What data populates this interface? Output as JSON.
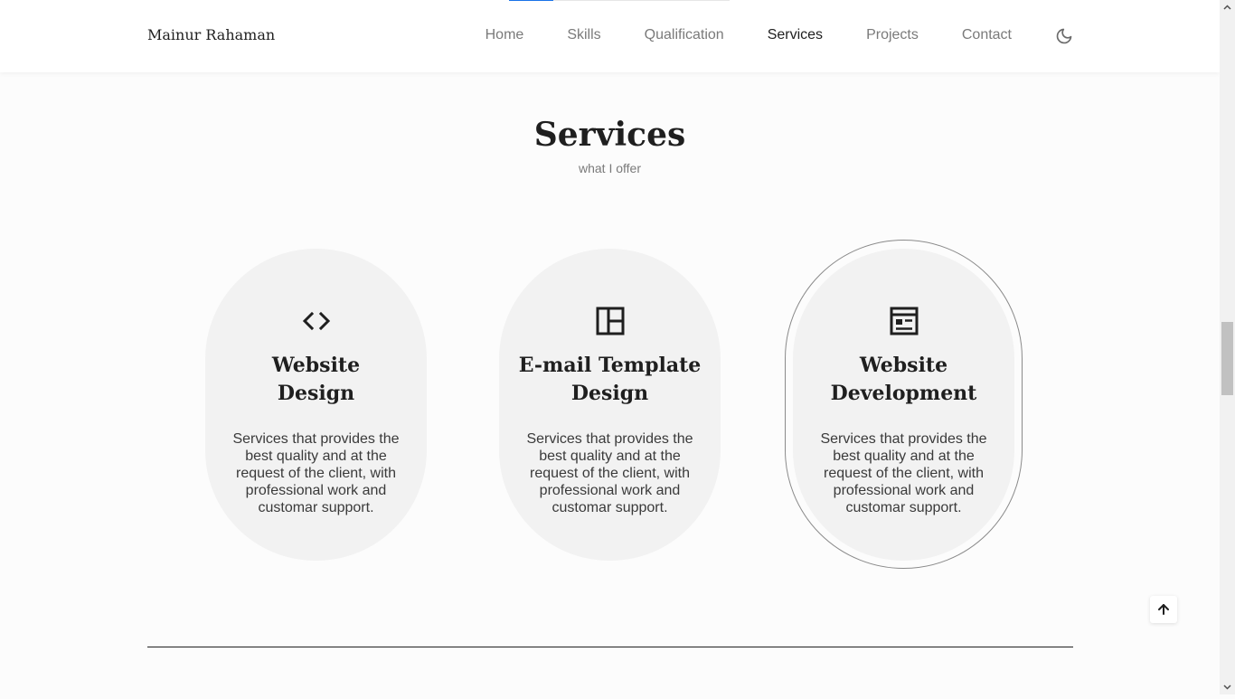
{
  "header": {
    "brand": "Mainur Rahaman",
    "nav": [
      {
        "label": "Home",
        "active": false
      },
      {
        "label": "Skills",
        "active": false
      },
      {
        "label": "Qualification",
        "active": false
      },
      {
        "label": "Services",
        "active": true
      },
      {
        "label": "Projects",
        "active": false
      },
      {
        "label": "Contact",
        "active": false
      }
    ],
    "theme_icon": "moon-icon"
  },
  "scroll_progress": 0.2,
  "section": {
    "title": "Services",
    "subtitle": "what I offer"
  },
  "services": [
    {
      "icon": "code-icon",
      "title": "Website Design",
      "title_line1": "Website",
      "title_line2": "Design",
      "description": "Services that provides the best quality and at the request of the client, with professional work and customar support."
    },
    {
      "icon": "layout-icon",
      "title": "E-mail Template Design",
      "title_line1": "E-mail Template",
      "title_line2": "Design",
      "description": "Services that provides the best quality and at the request of the client, with professional work and customar support."
    },
    {
      "icon": "newspaper-icon",
      "title": "Website Development",
      "title_line1": "Website",
      "title_line2": "Development",
      "description": "Services that provides the best quality and at the request of the client, with professional work and customar support."
    }
  ],
  "highlighted_service": 2,
  "scroll_up_icon": "arrow-up-icon",
  "colors": {
    "accent": "#1a73e8",
    "card_bg": "#f2f2f2",
    "text": "#1f1f1f",
    "muted": "#7a7a7a"
  }
}
